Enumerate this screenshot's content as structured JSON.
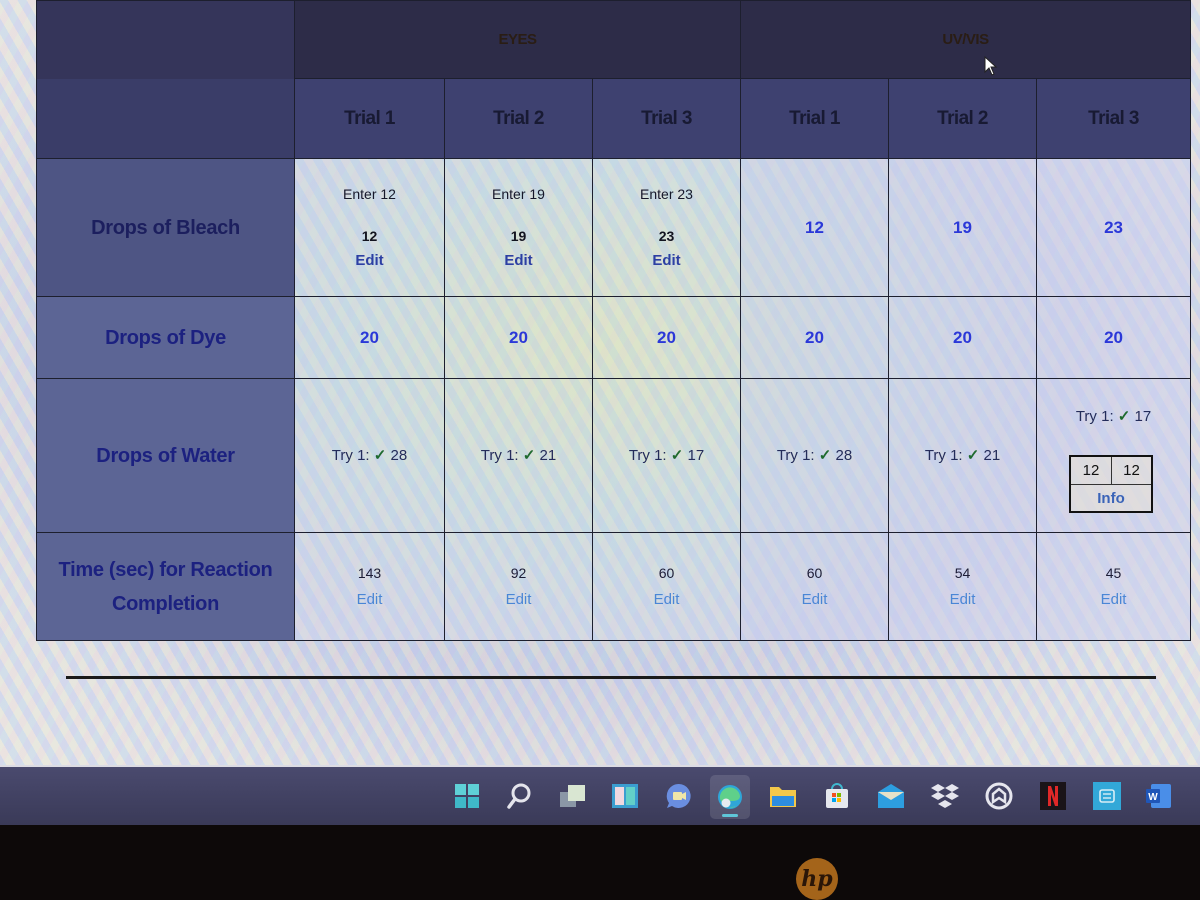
{
  "table": {
    "groups": [
      "EYES",
      "UV/VIS"
    ],
    "trial_headers": [
      "Trial 1",
      "Trial 2",
      "Trial 3",
      "Trial 1",
      "Trial 2",
      "Trial 3"
    ],
    "rows": {
      "bleach": {
        "label": "Drops of Bleach",
        "eyes": [
          {
            "prompt": "Enter 12",
            "value": "12",
            "action": "Edit"
          },
          {
            "prompt": "Enter 19",
            "value": "19",
            "action": "Edit"
          },
          {
            "prompt": "Enter 23",
            "value": "23",
            "action": "Edit"
          }
        ],
        "uvvis": [
          "12",
          "19",
          "23"
        ]
      },
      "dye": {
        "label": "Drops of Dye",
        "values": [
          "20",
          "20",
          "20",
          "20",
          "20",
          "20"
        ]
      },
      "water": {
        "label": "Drops of Water",
        "attempts": [
          {
            "prefix": "Try 1:",
            "check": "✓",
            "value": "28"
          },
          {
            "prefix": "Try 1:",
            "check": "✓",
            "value": "21"
          },
          {
            "prefix": "Try 1:",
            "check": "✓",
            "value": "17"
          },
          {
            "prefix": "Try 1:",
            "check": "✓",
            "value": "28"
          },
          {
            "prefix": "Try 1:",
            "check": "✓",
            "value": "21"
          },
          {
            "prefix": "Try 1:",
            "check": "✓",
            "value": "17"
          }
        ],
        "info_box": {
          "left": "12",
          "right": "12",
          "action": "Info"
        }
      },
      "time": {
        "label_line1": "Time (sec) for Reaction",
        "label_line2": "Completion",
        "values": [
          {
            "value": "143",
            "action": "Edit"
          },
          {
            "value": "92",
            "action": "Edit"
          },
          {
            "value": "60",
            "action": "Edit"
          },
          {
            "value": "60",
            "action": "Edit"
          },
          {
            "value": "54",
            "action": "Edit"
          },
          {
            "value": "45",
            "action": "Edit"
          }
        ]
      }
    }
  },
  "taskbar": {
    "icons": [
      "windows-start",
      "search",
      "task-view",
      "widgets",
      "teams-chat",
      "edge",
      "file-explorer",
      "microsoft-store",
      "mail",
      "dropbox",
      "app-circle",
      "netflix",
      "translator",
      "word"
    ],
    "active": "edge"
  },
  "bezel": {
    "logo": "hp"
  },
  "colors": {
    "header_bg": "#2d2c48",
    "trial_bg": "#3e4170",
    "rowhead_bg": "#5c6595",
    "accent_blue": "#2b38d8",
    "edit_blue": "#2c3fa3",
    "check_green": "#1e6a2e"
  }
}
